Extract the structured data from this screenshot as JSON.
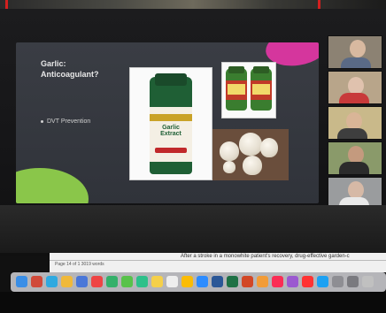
{
  "slide": {
    "title": "Garlic:\nAnticoagulant?",
    "bullet": "DVT Prevention",
    "main_bottle_label": "Garlic Extract"
  },
  "document": {
    "left_text": "Page 14 of 1   3019 words",
    "right_text": "After a stroke in a monowhite patient's recovery, drug-effective garden-c"
  },
  "dock_icons": [
    "finder-icon",
    "launchpad-icon",
    "safari-icon",
    "photos-icon",
    "mail-icon",
    "calendar-icon",
    "maps-icon",
    "messages-icon",
    "facetime-icon",
    "notes-icon",
    "reminders-icon",
    "chrome-icon",
    "zoom-icon",
    "word-icon",
    "excel-icon",
    "powerpoint-icon",
    "pages-icon",
    "music-icon",
    "podcasts-icon",
    "news-icon",
    "app-store-icon",
    "settings-icon",
    "system-prefs-icon",
    "trash-icon"
  ],
  "colors": {
    "slide_bg": "#34373e",
    "accent_pink": "#d5369d",
    "accent_green": "#8ac64a",
    "frame_red": "#d2201f"
  }
}
